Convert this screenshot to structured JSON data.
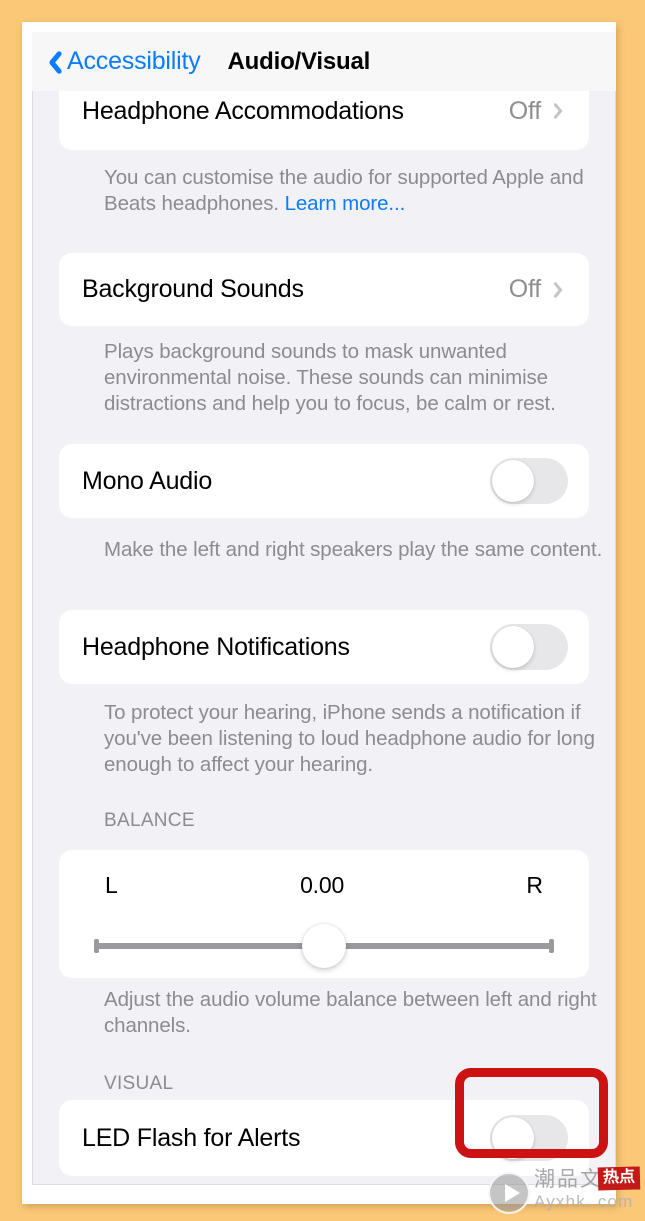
{
  "nav": {
    "back_label": "Accessibility",
    "title": "Audio/Visual",
    "back_icon": "chevron-left-icon"
  },
  "rows": {
    "headphone_accommodations": {
      "label": "Headphone Accommodations",
      "value": "Off",
      "disclosure_icon": "chevron-right-icon"
    },
    "headphone_accommodations_footer": "You can customise the audio for supported Apple and Beats headphones. ",
    "headphone_accommodations_link": "Learn more...",
    "background_sounds": {
      "label": "Background Sounds",
      "value": "Off",
      "disclosure_icon": "chevron-right-icon"
    },
    "background_sounds_footer": "Plays background sounds to mask unwanted environmental noise. These sounds can minimise distractions and help you to focus, be calm or rest.",
    "mono_audio": {
      "label": "Mono Audio",
      "state": "off"
    },
    "mono_audio_footer": "Make the left and right speakers play the same content.",
    "headphone_notifications": {
      "label": "Headphone Notifications",
      "state": "off"
    },
    "headphone_notifications_footer": "To protect your hearing, iPhone sends a notification if you've been listening to loud headphone audio for long enough to affect your hearing.",
    "led_flash": {
      "label": "LED Flash for Alerts",
      "state": "off"
    }
  },
  "sections": {
    "balance_header": "BALANCE",
    "visual_header": "VISUAL"
  },
  "balance": {
    "left_label": "L",
    "right_label": "R",
    "value": "0.00",
    "position_percent": 50,
    "footer": "Adjust the audio volume balance between left and right channels."
  },
  "annotation": {
    "color": "#cc1212",
    "target": "led-flash-toggle"
  },
  "watermark": {
    "play_icon": "play-circle-icon",
    "cn_text": "潮品文",
    "badge_text": "热点",
    "site": "Ayxhk. com"
  },
  "colors": {
    "accent_blue": "#0a7cff",
    "background_page": "#f1f1f6",
    "card_white": "#ffffff",
    "secondary_text": "#8b8b92",
    "annotation_red": "#cc1212",
    "outer_background": "#fbc878"
  }
}
